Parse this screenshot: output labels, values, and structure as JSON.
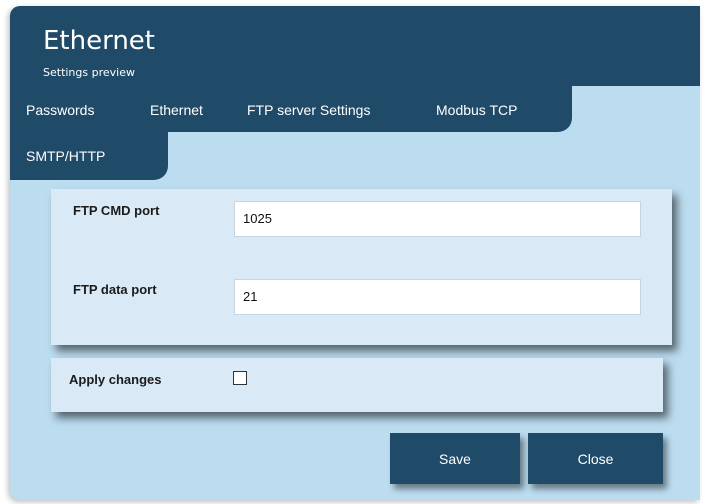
{
  "header": {
    "title": "Ethernet",
    "subtitle": "Settings preview"
  },
  "tabs": [
    {
      "label": "Passwords"
    },
    {
      "label": "Ethernet"
    },
    {
      "label": "FTP server Settings"
    },
    {
      "label": "Modbus TCP"
    },
    {
      "label": "SMTP/HTTP"
    }
  ],
  "form": {
    "ftp_cmd_port": {
      "label": "FTP CMD port",
      "value": "1025"
    },
    "ftp_data_port": {
      "label": "FTP data port",
      "value": "21"
    },
    "apply_changes": {
      "label": "Apply changes",
      "checked": false
    }
  },
  "buttons": {
    "save": "Save",
    "close": "Close"
  },
  "colors": {
    "accent": "#1f4a68",
    "background": "#bcdcf0",
    "panel": "#d9e9f5"
  }
}
